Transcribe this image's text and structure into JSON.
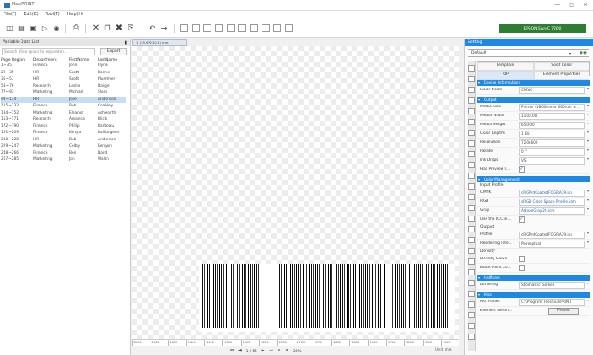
{
  "app": {
    "title": "MaxiPRINT",
    "window_controls": [
      "—",
      "□",
      "×"
    ]
  },
  "menu": [
    "File(F)",
    "Edit(E)",
    "Tool(T)",
    "Help(H)"
  ],
  "toolbar": {
    "printer_label": "EPSON SureC 7200"
  },
  "left_panel": {
    "title": "Variable Data List",
    "search_placeholder": "Search (Use space to separate)...",
    "export_label": "Export",
    "columns": [
      "Page Region",
      "Department",
      "FirstName",
      "LastName"
    ],
    "rows": [
      [
        "1~35",
        "Finance",
        "John",
        "Flynn"
      ],
      [
        "20~35",
        "HR",
        "Scott",
        "Barros"
      ],
      [
        "35~57",
        "HR",
        "Scott",
        "Plummer"
      ],
      [
        "58~76",
        "Research",
        "Leslie",
        "Daigle"
      ],
      [
        "77~93",
        "Marketing",
        "Michael",
        "Sloss"
      ],
      [
        "94~114",
        "HR",
        "Jose",
        "Anderson"
      ],
      [
        "115~133",
        "Finance",
        "Bob",
        "Coakley"
      ],
      [
        "134~152",
        "Marketing",
        "Eleanor",
        "Ashworth"
      ],
      [
        "153~171",
        "Research",
        "Amanda",
        "Blick"
      ],
      [
        "172~190",
        "Finance",
        "Philip",
        "Barbeau"
      ],
      [
        "191~209",
        "Finance",
        "Kenya",
        "Baillargeon"
      ],
      [
        "210~228",
        "HR",
        "Bob",
        "Anderson"
      ],
      [
        "229~247",
        "Marketing",
        "Colby",
        "Kenyon"
      ],
      [
        "248~266",
        "Finance",
        "Ben",
        "Nardi"
      ],
      [
        "267~285",
        "Marketing",
        "Jon",
        "Walsh"
      ]
    ],
    "selected_row": 5
  },
  "document": {
    "tab_label": "1 (29.6*210.8) mm",
    "ruler": [
      "1250",
      "1300",
      "1350",
      "1400",
      "1450",
      "1500",
      "1550",
      "1600",
      "1650",
      "1700",
      "1750",
      "1800",
      "1850",
      "1900",
      "1950",
      "2000",
      "2050",
      "2100"
    ],
    "nav": {
      "first": "⏮",
      "prev": "◀",
      "page": "1 / 65",
      "next": "▶",
      "last": "⏭",
      "zoom": "22%",
      "unit": "Unit: mm"
    }
  },
  "right_panel": {
    "title": "Setting",
    "preset": "Default",
    "tabs": [
      "Template",
      "Spot Color",
      "RIP",
      "Element Properties"
    ],
    "active_tab": "RIP",
    "sections": [
      {
        "title": "Device Information",
        "rows": [
          [
            "Color Mode",
            "CMYK"
          ]
        ]
      },
      {
        "title": "Output",
        "rows": [
          [
            "Media Size",
            "Printer (1800mm x 600mm x ..."
          ],
          [
            "Media Width",
            "1100.00"
          ],
          [
            "Media Height",
            "650.00"
          ],
          [
            "Color Depths",
            "1 Bit"
          ],
          [
            "Resolution",
            "720x600"
          ],
          [
            "Rotate",
            "0 °"
          ],
          [
            "Ink Drops",
            "VS"
          ],
          [
            "Has Preview I...",
            "✓"
          ]
        ]
      },
      {
        "title": "Color Management",
        "input_label": "Input Profile",
        "rows": [
          [
            "CMYK",
            "cRGPrdCoatedFOGRA39.icc"
          ],
          [
            "RGB",
            "sRGB Color Space Profile.icm"
          ],
          [
            "Gray",
            "AdobeGray20.icm"
          ],
          [
            "Use the ICC in...",
            "✓"
          ]
        ],
        "output_label": "Output",
        "rows2": [
          [
            "Profile",
            "cRGPrdCoatedFOGRA39.icc"
          ],
          [
            "Rendering Inte...",
            "Perceptual"
          ]
        ],
        "density_label": "Density",
        "rows3": [
          [
            "Density Curve",
            ""
          ],
          [
            "Black Point Co...",
            ""
          ]
        ]
      },
      {
        "title": "Halftone",
        "rows": [
          [
            "Dithering",
            "Stochastic Screen"
          ]
        ]
      },
      {
        "title": "Misc",
        "rows": [
          [
            "Hot Folder",
            "C:\\Program Files\\SunPRINT"
          ],
          [
            "Element Settin...",
            "Preset"
          ]
        ]
      }
    ]
  },
  "colors": {
    "accent": "#1e88e5",
    "printer_button": "#2e7d32",
    "row_selected": "#c6ddf2"
  }
}
